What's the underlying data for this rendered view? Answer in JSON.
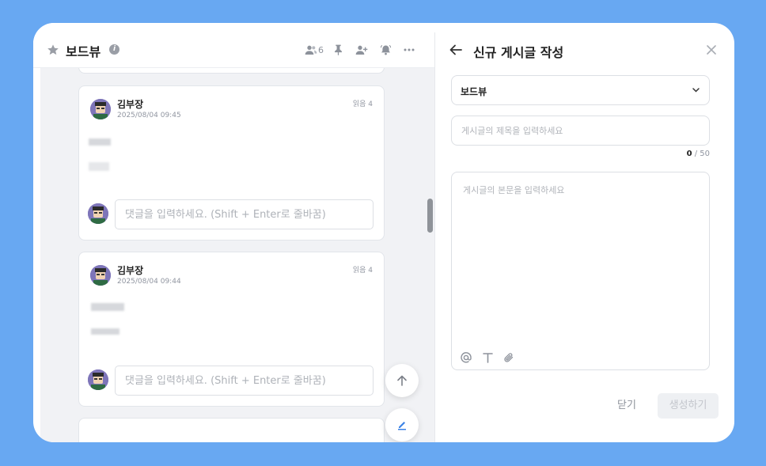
{
  "board": {
    "title": "보드뷰",
    "member_count": "6"
  },
  "posts": [
    {
      "author": "김부장",
      "timestamp": "2025/08/04 09:45",
      "reads": "읽음 4",
      "comment_placeholder": "댓글을 입력하세요. (Shift + Enter로 줄바꿈)"
    },
    {
      "author": "김부장",
      "timestamp": "2025/08/04 09:44",
      "reads": "읽음 4",
      "comment_placeholder": "댓글을 입력하세요. (Shift + Enter로 줄바꿈)"
    }
  ],
  "new_post": {
    "title": "신규 게시글 작성",
    "board_select": "보드뷰",
    "title_placeholder": "게시글의 제목을 입력하세요",
    "title_count": "0",
    "title_max": " / 50",
    "body_placeholder": "게시글의 본문을 입력하세요",
    "close_label": "닫기",
    "create_label": "생성하기"
  },
  "colors": {
    "background": "#68a8f2",
    "accent": "#3b82e6"
  }
}
